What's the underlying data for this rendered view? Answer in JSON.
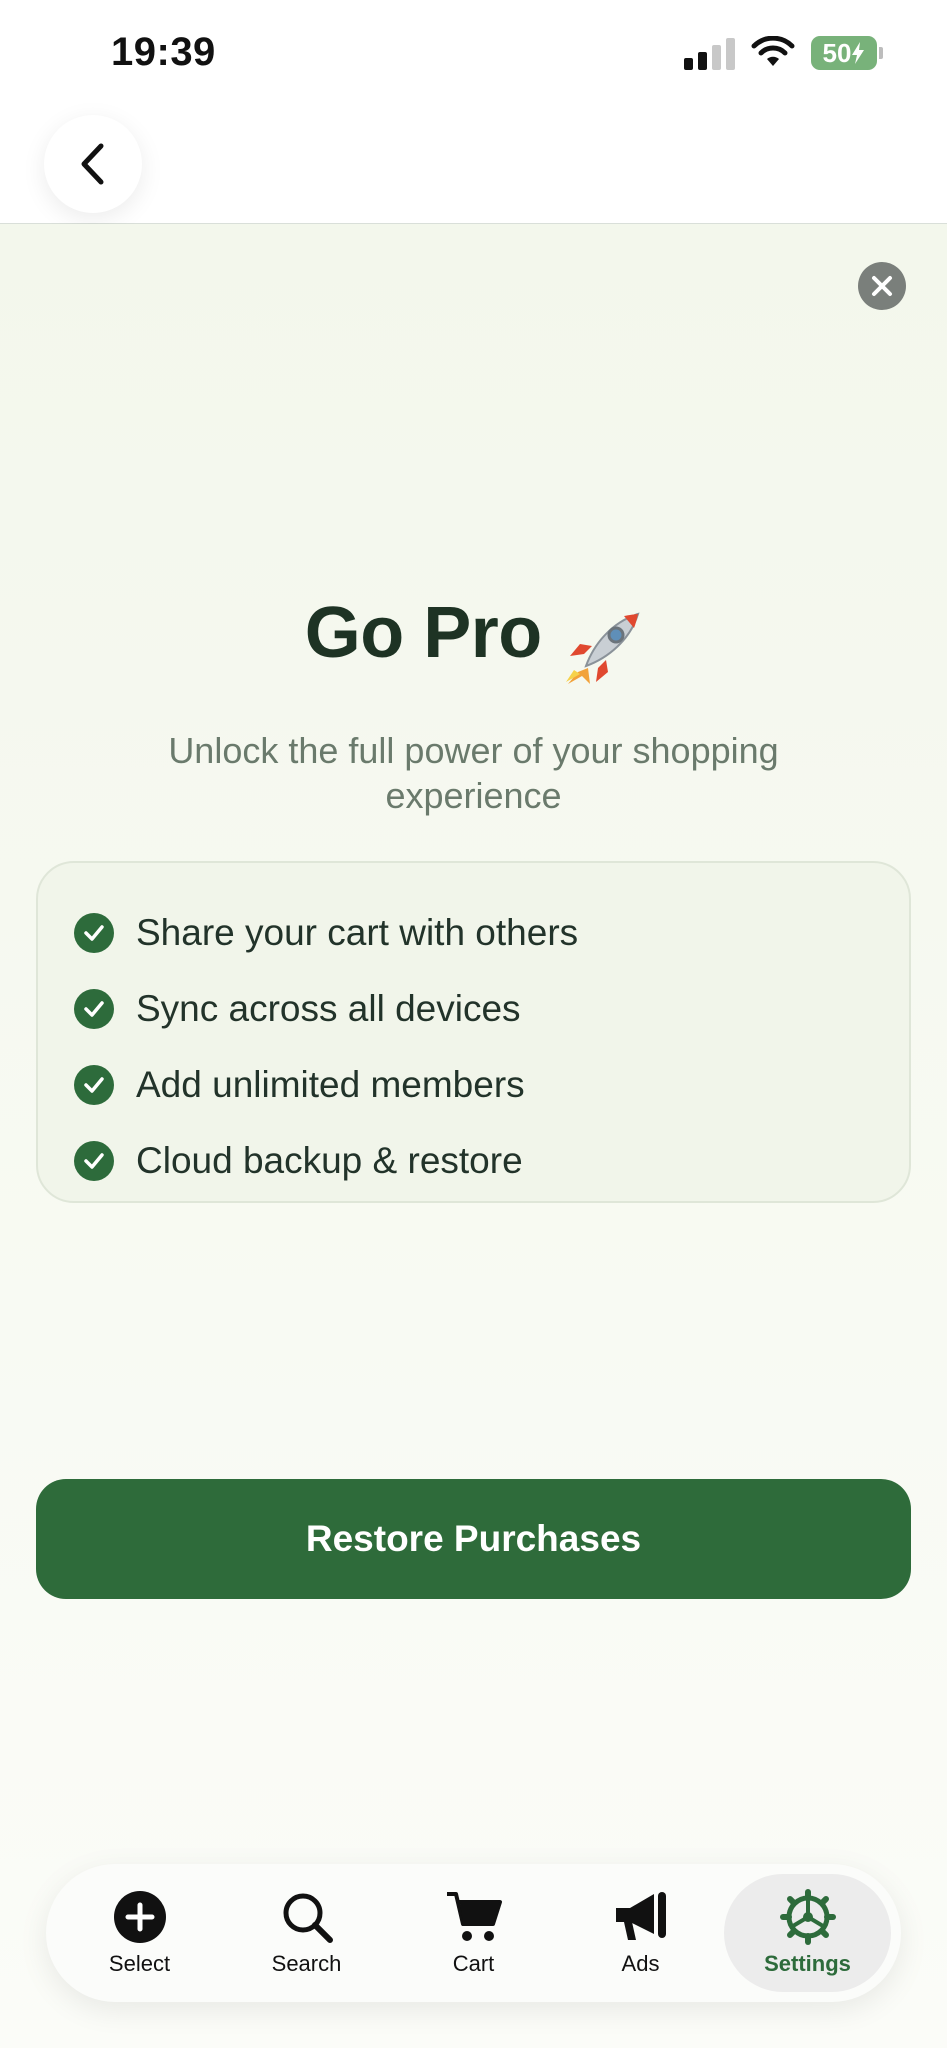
{
  "status_bar": {
    "time": "19:39",
    "battery": "50",
    "icons": [
      "signal-icon",
      "wifi-icon",
      "battery-icon"
    ]
  },
  "nav": {
    "back_icon": "chevron-left-icon"
  },
  "paywall": {
    "close_icon": "close-icon",
    "title": "Go Pro",
    "title_emoji_icon": "rocket-icon",
    "subtitle": "Unlock the full power of your shopping experience",
    "features": [
      {
        "label": "Share your cart with others"
      },
      {
        "label": "Sync across all devices"
      },
      {
        "label": "Add unlimited members"
      },
      {
        "label": "Cloud backup & restore"
      }
    ],
    "restore_label": "Restore Purchases"
  },
  "tab_bar": {
    "tabs": [
      {
        "label": "Select",
        "icon": "plus-circle-icon",
        "active": false
      },
      {
        "label": "Search",
        "icon": "search-icon",
        "active": false
      },
      {
        "label": "Cart",
        "icon": "cart-icon",
        "active": false
      },
      {
        "label": "Ads",
        "icon": "megaphone-icon",
        "active": false
      },
      {
        "label": "Settings",
        "icon": "gear-icon",
        "active": true
      }
    ]
  },
  "colors": {
    "accent": "#2e6b3a",
    "background": "#f3f7ec",
    "title": "#1e3324",
    "subtitle": "#6a7a6c"
  }
}
